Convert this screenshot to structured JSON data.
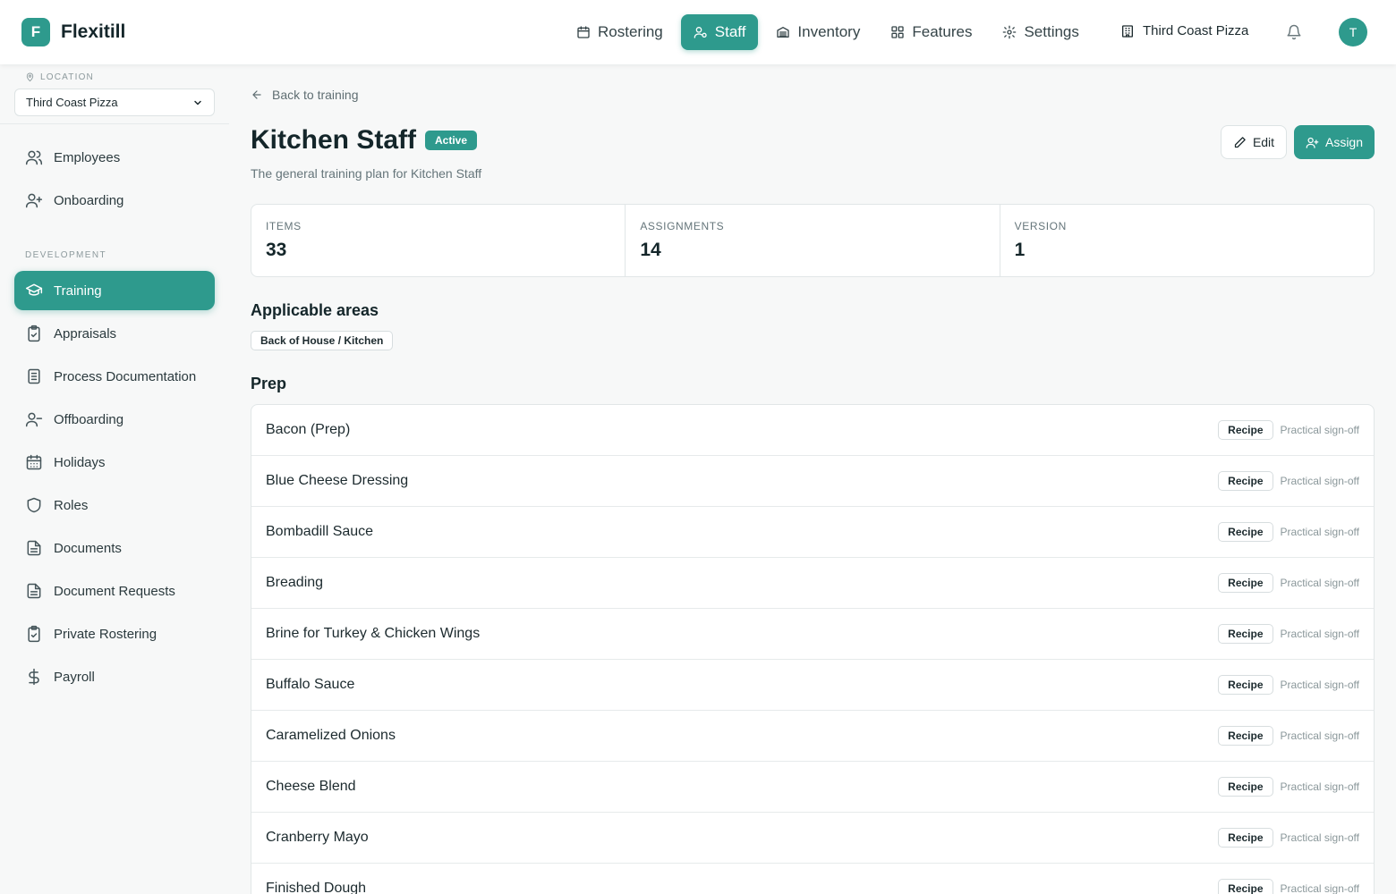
{
  "brand": {
    "logo_letter": "F",
    "name": "Flexitill"
  },
  "nav": {
    "items": [
      {
        "label": "Rostering",
        "icon": "calendar-icon"
      },
      {
        "label": "Staff",
        "icon": "staff-icon"
      },
      {
        "label": "Inventory",
        "icon": "inventory-icon"
      },
      {
        "label": "Features",
        "icon": "grid-icon"
      },
      {
        "label": "Settings",
        "icon": "gear-icon"
      }
    ],
    "active": "Staff",
    "location": "Third Coast Pizza",
    "avatar_initial": "T"
  },
  "sidebar": {
    "location_label": "LOCATION",
    "location_value": "Third Coast Pizza",
    "top_items": [
      {
        "label": "Employees",
        "icon": "users-icon"
      },
      {
        "label": "Onboarding",
        "icon": "user-plus-icon"
      }
    ],
    "section_label": "DEVELOPMENT",
    "dev_items": [
      {
        "label": "Training",
        "icon": "graduation-cap-icon",
        "active": true
      },
      {
        "label": "Appraisals",
        "icon": "clipboard-check-icon"
      },
      {
        "label": "Process Documentation",
        "icon": "document-list-icon"
      },
      {
        "label": "Offboarding",
        "icon": "user-minus-icon"
      },
      {
        "label": "Holidays",
        "icon": "calendar-grid-icon"
      },
      {
        "label": "Roles",
        "icon": "shield-icon"
      },
      {
        "label": "Documents",
        "icon": "file-text-icon"
      },
      {
        "label": "Document Requests",
        "icon": "file-text-icon"
      },
      {
        "label": "Private Rostering",
        "icon": "clipboard-check-icon"
      },
      {
        "label": "Payroll",
        "icon": "dollar-icon"
      }
    ]
  },
  "main": {
    "back_label": "Back to training",
    "title": "Kitchen Staff",
    "status": "Active",
    "description": "The general training plan for Kitchen Staff",
    "edit_label": "Edit",
    "assign_label": "Assign",
    "stats": [
      {
        "label": "ITEMS",
        "value": "33"
      },
      {
        "label": "ASSIGNMENTS",
        "value": "14"
      },
      {
        "label": "VERSION",
        "value": "1"
      }
    ],
    "areas_title": "Applicable areas",
    "areas": [
      "Back of House / Kitchen"
    ],
    "section_title": "Prep",
    "items": [
      {
        "name": "Bacon (Prep)",
        "type": "Recipe",
        "signoff": "Practical sign-off"
      },
      {
        "name": "Blue Cheese Dressing",
        "type": "Recipe",
        "signoff": "Practical sign-off"
      },
      {
        "name": "Bombadill Sauce",
        "type": "Recipe",
        "signoff": "Practical sign-off"
      },
      {
        "name": "Breading",
        "type": "Recipe",
        "signoff": "Practical sign-off"
      },
      {
        "name": "Brine for Turkey & Chicken Wings",
        "type": "Recipe",
        "signoff": "Practical sign-off"
      },
      {
        "name": "Buffalo Sauce",
        "type": "Recipe",
        "signoff": "Practical sign-off"
      },
      {
        "name": "Caramelized Onions",
        "type": "Recipe",
        "signoff": "Practical sign-off"
      },
      {
        "name": "Cheese Blend",
        "type": "Recipe",
        "signoff": "Practical sign-off"
      },
      {
        "name": "Cranberry Mayo",
        "type": "Recipe",
        "signoff": "Practical sign-off"
      },
      {
        "name": "Finished Dough",
        "type": "Recipe",
        "signoff": "Practical sign-off"
      }
    ]
  },
  "colors": {
    "accent": "#2e9a8d",
    "background": "#f7f8f8"
  }
}
